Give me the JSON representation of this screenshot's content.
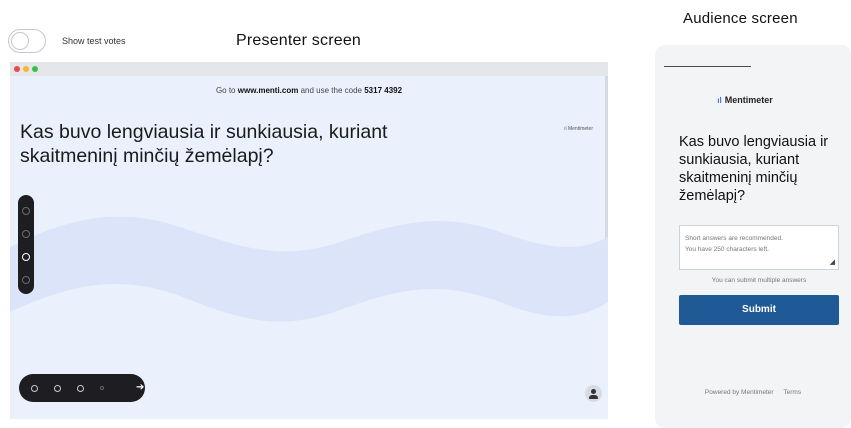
{
  "toggle": {
    "label": "Show test votes",
    "enabled": false
  },
  "presenter": {
    "title": "Presenter screen",
    "goto_prefix": "Go to",
    "goto_url": "www.menti.com",
    "goto_mid": "and use the code",
    "code": "5317 4392",
    "question": "Kas buvo lengviausia ir sunkiausia, kuriant skaitmeninį minčių žemėlapį?",
    "logo": "Mentimeter",
    "window_dots": [
      "#e84a4a",
      "#f5b72e",
      "#35c24a"
    ],
    "wave_color": "#dbe4f8",
    "background": "#eaf0fc"
  },
  "audience": {
    "title": "Audience screen",
    "logo": "Mentimeter",
    "question": "Kas buvo lengviausia ir sunkiausia, kuriant skaitmeninį minčių žemėlapį?",
    "placeholder_line1": "Short answers are recommended.",
    "placeholder_line2": "You have 250 characters left.",
    "multiple_note": "You can submit multiple answers",
    "submit_label": "Submit",
    "footer_powered": "Powered by Mentimeter",
    "footer_terms": "Terms",
    "submit_color": "#1f5a96"
  }
}
